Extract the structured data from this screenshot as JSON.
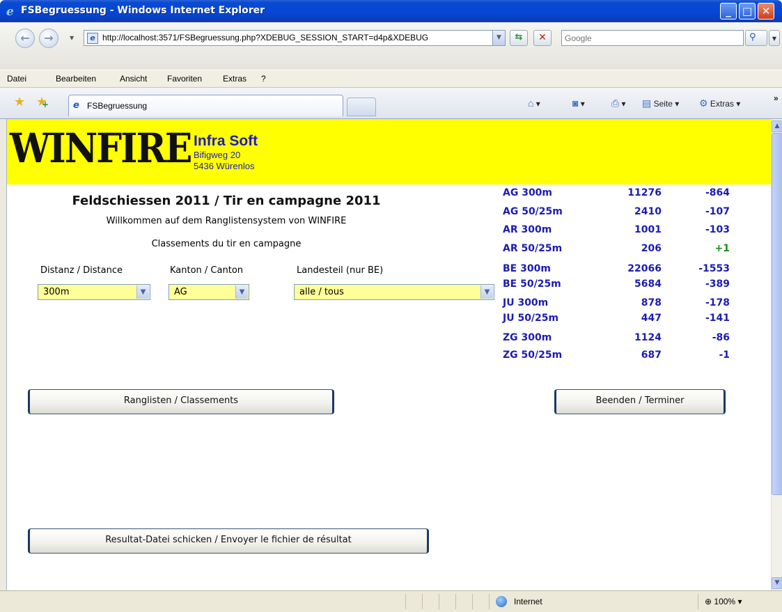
{
  "window": {
    "title": "FSBegruessung - Windows Internet Explorer",
    "colors": {
      "titlebar": "#0548d8",
      "close_button": "#c8401c"
    }
  },
  "addressbar": {
    "url": "http://localhost:3571/FSBegruessung.php?XDEBUG_SESSION_START=d4p&XDEBUG",
    "search_placeholder": "Google"
  },
  "menu": {
    "items": [
      "Datei",
      "Bearbeiten",
      "Ansicht",
      "Favoriten",
      "Extras",
      "?"
    ]
  },
  "tabs": {
    "active_label": "FSBegruessung"
  },
  "toolbar": {
    "page_label": "Seite",
    "tools_label": "Extras"
  },
  "page": {
    "banner_color": "#ffff00",
    "logo_text": "WINFIRE",
    "company": {
      "name": "Infra Soft",
      "street": "Bifigweg 20",
      "city": "5436 Würenlos"
    },
    "title": "Feldschiessen 2011 / Tir en campagne 2011",
    "subtitle_de": "Willkommen auf dem Ranglistensystem von WINFIRE",
    "subtitle_fr": "Classements du tir en campagne",
    "filters": {
      "distance_label": "Distanz / Distance",
      "distance_value": "300m",
      "canton_label": "Kanton / Canton",
      "canton_value": "AG",
      "region_label": "Landesteil (nur BE)",
      "region_value": "alle / tous"
    },
    "stats": [
      {
        "label": "AG 300m",
        "count": "11276",
        "diff": "-864"
      },
      {
        "label": "AG 50/25m",
        "count": "2410",
        "diff": "-107"
      },
      {
        "label": "AR 300m",
        "count": "1001",
        "diff": "-103"
      },
      {
        "label": "AR 50/25m",
        "count": "206",
        "diff": "+1"
      },
      {
        "label": "BE 300m",
        "count": "22066",
        "diff": "-1553"
      },
      {
        "label": "BE 50/25m",
        "count": "5684",
        "diff": "-389"
      },
      {
        "label": "JU 300m",
        "count": "878",
        "diff": "-178"
      },
      {
        "label": "JU 50/25m",
        "count": "447",
        "diff": "-141"
      },
      {
        "label": "ZG 300m",
        "count": "1124",
        "diff": "-86"
      },
      {
        "label": "ZG 50/25m",
        "count": "687",
        "diff": "-1"
      }
    ],
    "stat_colors": {
      "default": "#1c1cb4",
      "positive": "#1d8a1d"
    },
    "buttons": {
      "rankings": "Ranglisten / Classements",
      "exit": "Beenden / Terminer",
      "send_results": "Resultat-Datei schicken / Envoyer le fichier de résultat"
    }
  },
  "statusbar": {
    "zone": "Internet",
    "zoom": "100%"
  }
}
